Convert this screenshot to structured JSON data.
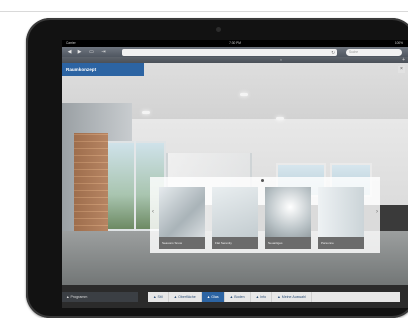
{
  "status_bar": {
    "carrier": "Carrier",
    "time": "7:30 PM",
    "battery": "100%"
  },
  "browser": {
    "search_placeholder": "Suche"
  },
  "app": {
    "title": "Raumkonzept",
    "close_label": "×"
  },
  "carousel": {
    "items": [
      {
        "label": "Seasons Snow"
      },
      {
        "label": "Flat Serenity"
      },
      {
        "label": "Neuartiges"
      },
      {
        "label": "Parsonne"
      }
    ]
  },
  "bottom_bar": {
    "program_label": "▲ Programm",
    "actions": [
      {
        "label": "▲ Stil"
      },
      {
        "label": "▲ Oberfläche"
      },
      {
        "label": "▲ Glas"
      },
      {
        "label": "▲ Boden"
      },
      {
        "label": "▲ Info"
      },
      {
        "label": "▲ Meine Auswahl"
      }
    ],
    "active_index": 2
  },
  "colors": {
    "accent": "#2c64a3",
    "device": "#121212"
  }
}
